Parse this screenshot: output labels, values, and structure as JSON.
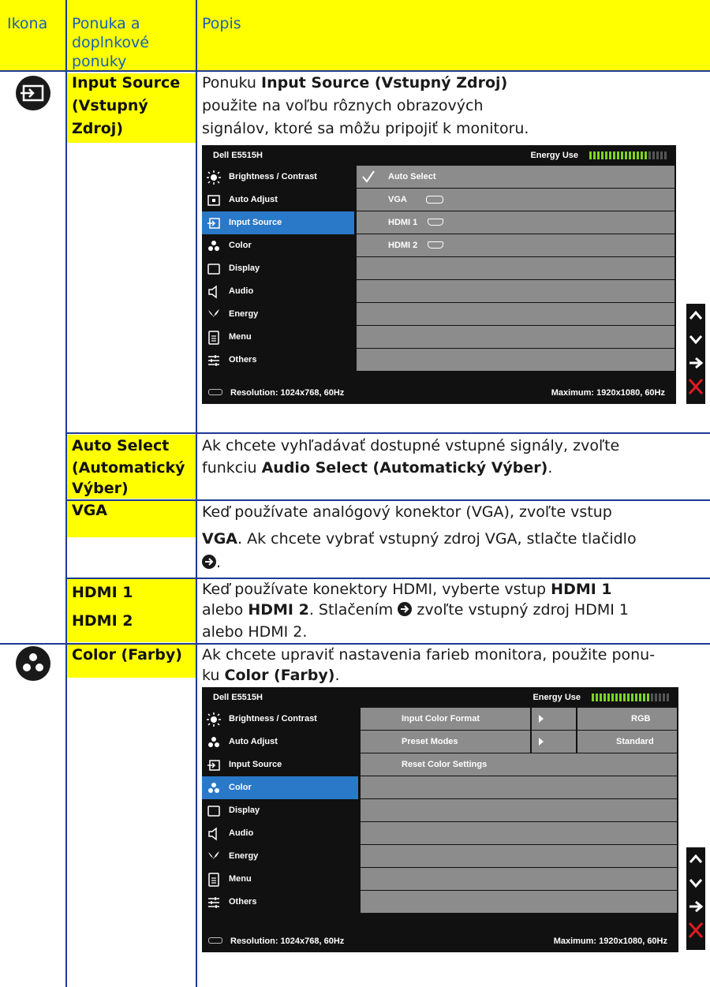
{
  "header": {
    "col1": "Ikona",
    "col2_line1": "Ponuka a",
    "col2_line2": "doplnkové",
    "col2_line3": "ponuky",
    "col3": "Popis"
  },
  "rows": {
    "input_source": {
      "name_l1": "Input Source",
      "name_l2": "(Vstupný",
      "name_l3": "Zdroj)",
      "d1_pre": "Ponuku ",
      "d1_bold": "Input Source (Vstupný Zdroj)",
      "d2": "použite na voľbu rôznych obrazových",
      "d3": "signálov, ktoré sa môžu pripojiť k monitoru."
    },
    "auto_select": {
      "name_l1": "Auto Select",
      "name_l2": "(Automatický",
      "name_l3": "Výber)",
      "d1": "Ak chcete vyhľadávať dostupné vstupné signály, zvoľte",
      "d2_pre": "funkciu ",
      "d2_bold": "Audio Select (Automatický Výber)",
      "d2_post": "."
    },
    "vga": {
      "name": "VGA",
      "d1": "Keď používate analógový konektor (VGA), zvoľte vstup",
      "d2_bold": "VGA",
      "d2_post": ". Ak chcete vybrať vstupný zdroj VGA, stlačte tlačidlo",
      "d3_post": "."
    },
    "hdmi": {
      "name1": "HDMI 1",
      "name2": "HDMI 2",
      "d1_pre": "Keď používate konektory HDMI, vyberte vstup ",
      "d1_bold": "HDMI 1",
      "d2_pre": "alebo ",
      "d2_bold": "HDMI 2",
      "d2_mid": ". Stlačením ",
      "d2_post": " zvoľte vstupný zdroj HDMI 1",
      "d3": "alebo HDMI 2."
    },
    "color": {
      "name": "Color (Farby)",
      "d1": "Ak chcete upraviť nastavenia farieb monitora, použite ponu-",
      "d2_pre": "ku ",
      "d2_bold": "Color (Farby)",
      "d2_post": "."
    }
  },
  "osd": {
    "model": "Dell E5515H",
    "energy_label": "Energy Use",
    "menu": [
      "Brightness / Contrast",
      "Auto Adjust",
      "Input Source",
      "Color",
      "Display",
      "Audio",
      "Energy",
      "Menu",
      "Others"
    ],
    "footer_res": "Resolution: 1024x768, 60Hz",
    "footer_max": "Maximum: 1920x1080, 60Hz",
    "input_options": [
      "Auto Select",
      "VGA",
      "HDMI 1",
      "HDMI 2"
    ],
    "color_options": [
      {
        "label": "Input Color Format",
        "value": "RGB"
      },
      {
        "label": "Preset Modes",
        "value": "Standard"
      },
      {
        "label": "Reset Color Settings",
        "value": ""
      }
    ]
  },
  "colors": {
    "highlight": "#ffff00",
    "link_blue": "#1a5fb4",
    "osd_selected": "#2a78c8",
    "osd_row": "#8c8c8c",
    "exit_red": "#e01b24"
  }
}
